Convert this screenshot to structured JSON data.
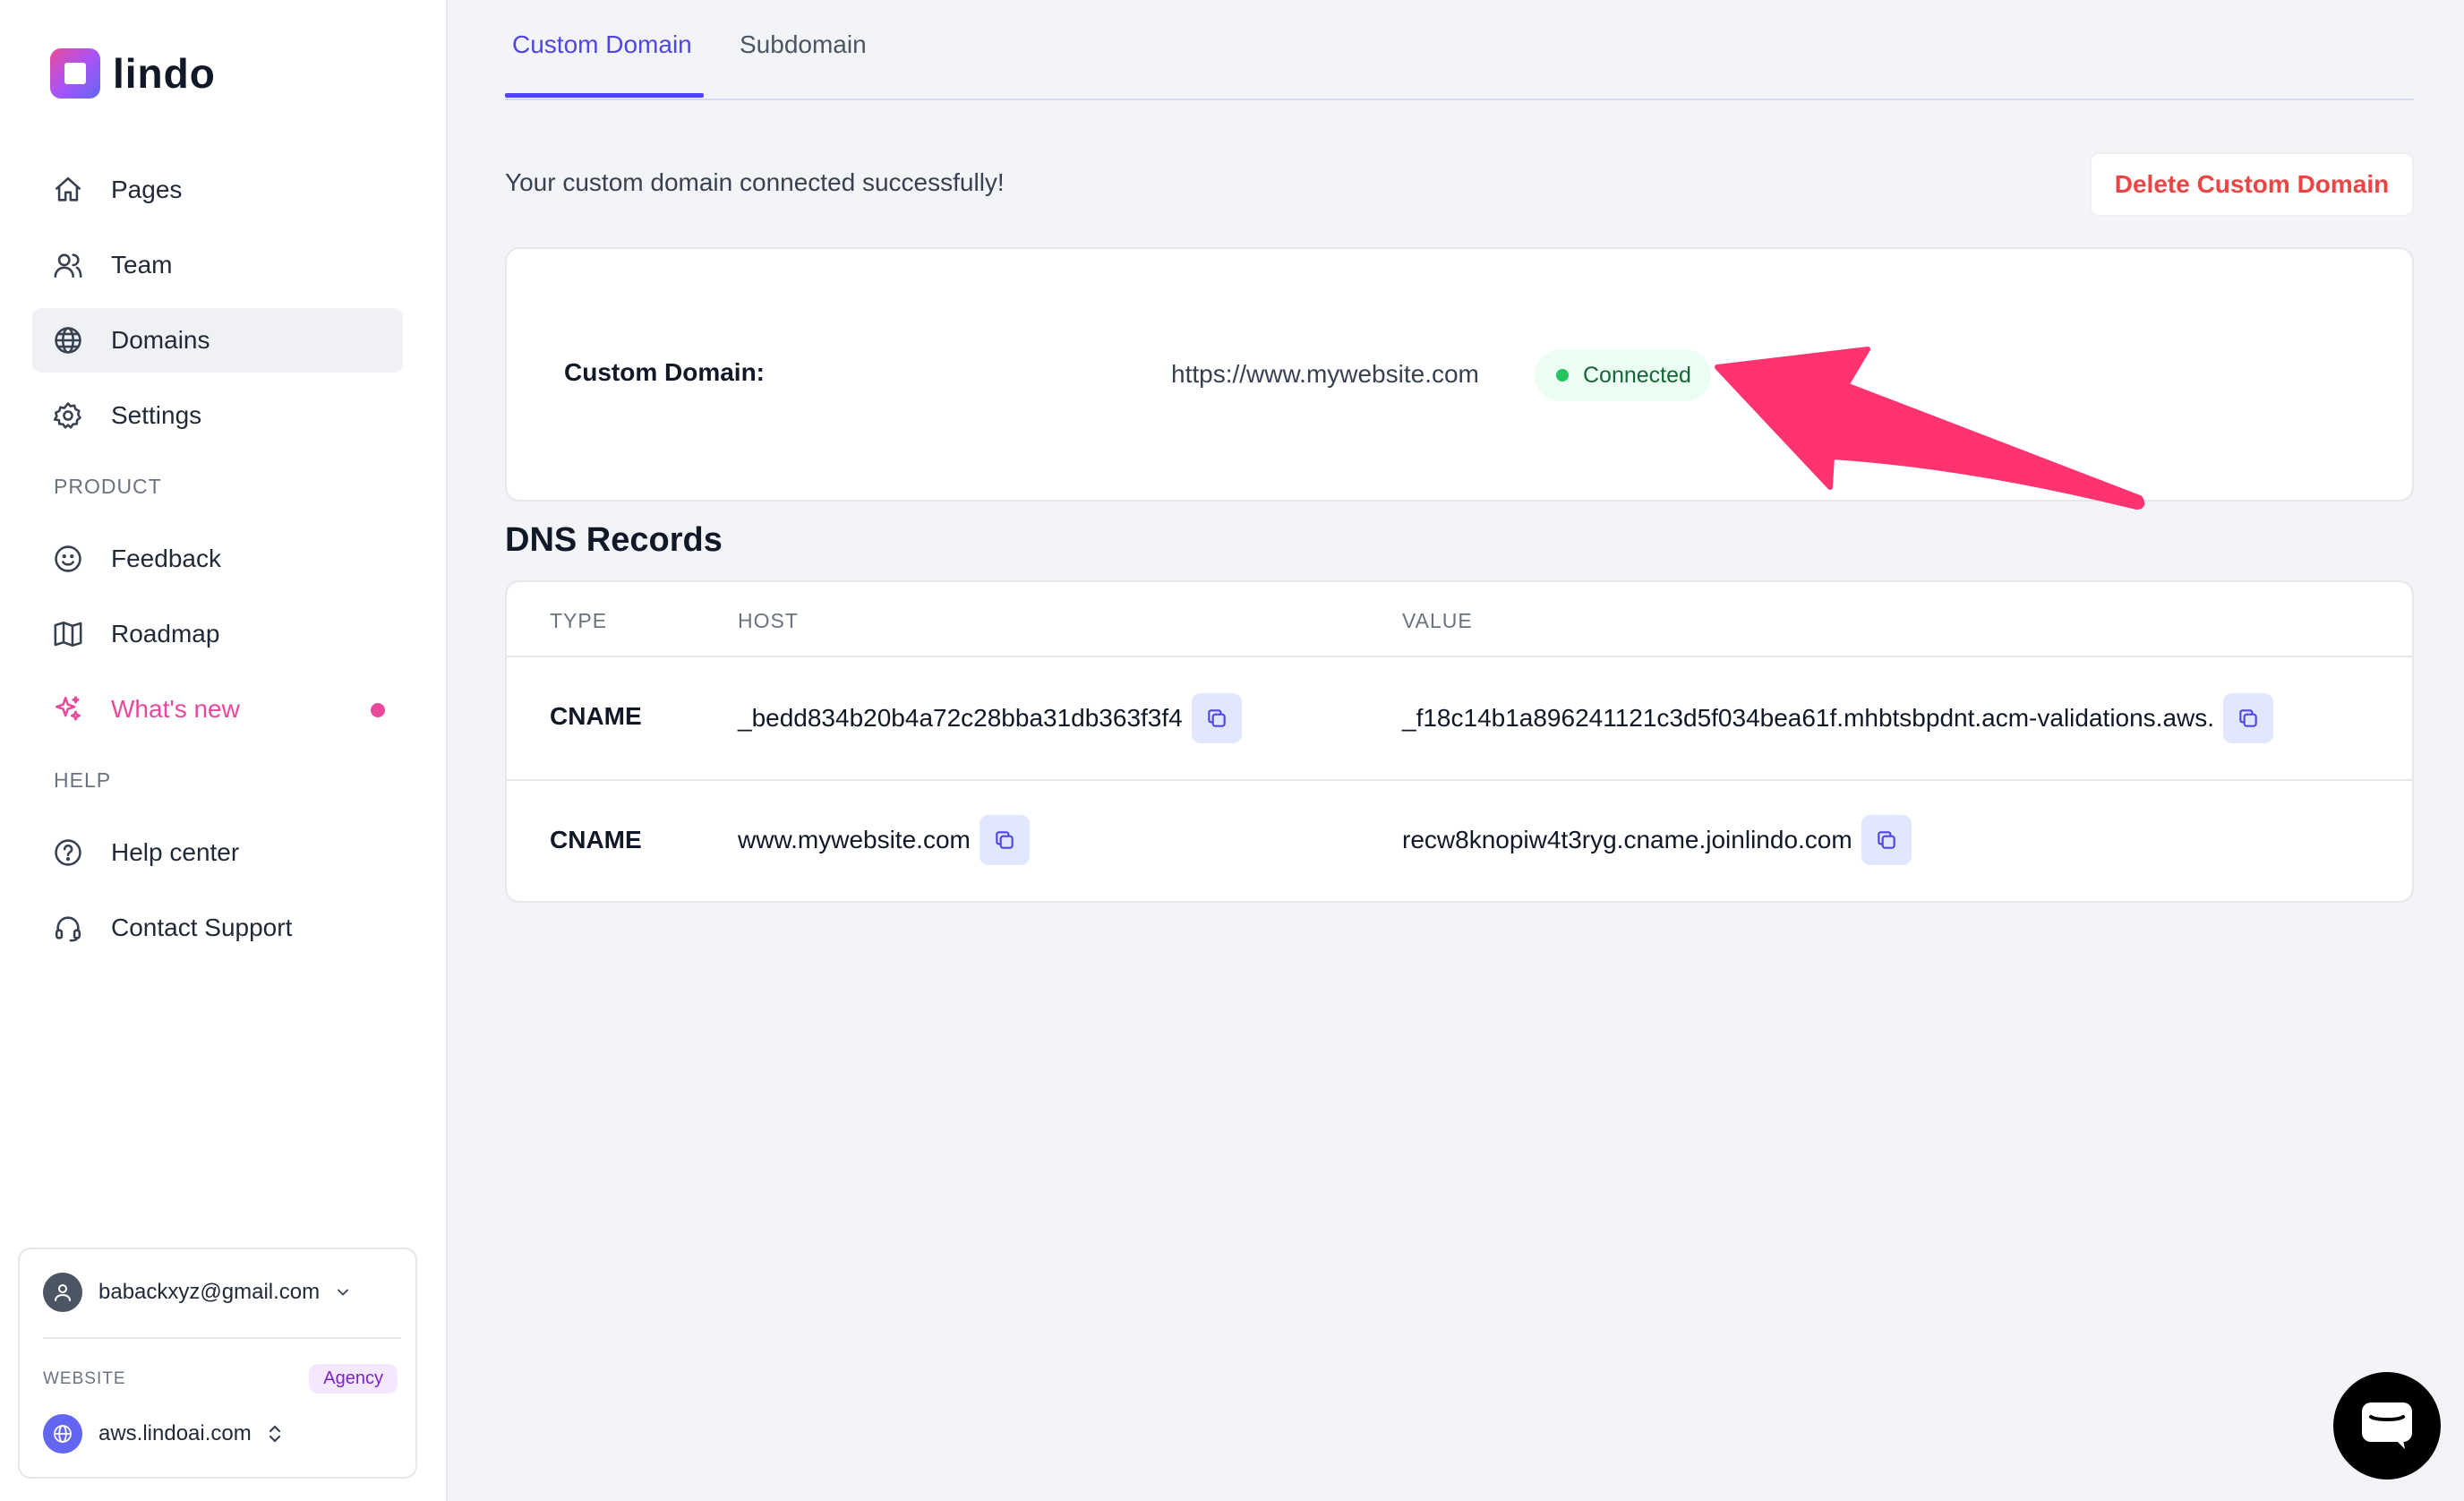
{
  "brand": {
    "name": "lindo"
  },
  "sidebar": {
    "items": [
      {
        "label": "Pages",
        "icon": "home-icon"
      },
      {
        "label": "Team",
        "icon": "users-icon"
      },
      {
        "label": "Domains",
        "icon": "globe-icon"
      },
      {
        "label": "Settings",
        "icon": "gear-icon"
      }
    ],
    "product_label": "PRODUCT",
    "product_items": [
      {
        "label": "Feedback",
        "icon": "smile-icon"
      },
      {
        "label": "Roadmap",
        "icon": "map-icon"
      },
      {
        "label": "What's new",
        "icon": "sparkles-icon"
      }
    ],
    "help_label": "HELP",
    "help_items": [
      {
        "label": "Help center",
        "icon": "help-circle-icon"
      },
      {
        "label": "Contact Support",
        "icon": "headset-icon"
      }
    ],
    "account": {
      "email": "babackxyz@gmail.com",
      "website_label": "WEBSITE",
      "badge": "Agency",
      "site": "aws.lindoai.com"
    }
  },
  "tabs": [
    {
      "label": "Custom Domain",
      "active": true
    },
    {
      "label": "Subdomain",
      "active": false
    }
  ],
  "main": {
    "success_message": "Your custom domain connected successfully!",
    "delete_label": "Delete Custom Domain",
    "custom_domain_label": "Custom Domain:",
    "custom_domain_value": "https://www.mywebsite.com",
    "status": "Connected",
    "dns_title": "DNS Records",
    "dns_headers": {
      "type": "TYPE",
      "host": "HOST",
      "value": "VALUE"
    },
    "dns_records": [
      {
        "type": "CNAME",
        "host": "_bedd834b20b4a72c28bba31db363f3f4",
        "value": "_f18c14b1a896241121c3d5f034bea61f.mhbtsbpdnt.acm-validations.aws."
      },
      {
        "type": "CNAME",
        "host": "www.mywebsite.com",
        "value": "recw8knopiw4t3ryg.cname.joinlindo.com"
      }
    ]
  },
  "colors": {
    "accent": "#4f46e5",
    "danger": "#ef4444",
    "success": "#22c55e",
    "annotation_arrow": "#ff3370"
  }
}
